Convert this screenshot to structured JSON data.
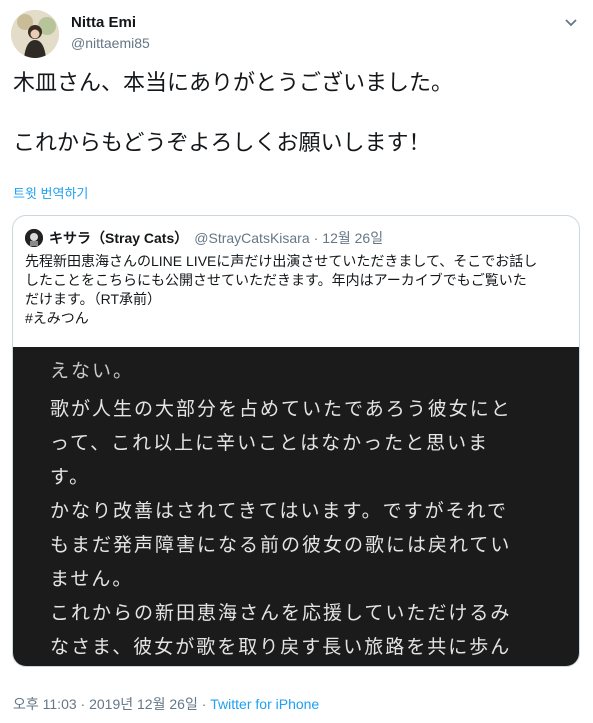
{
  "author": {
    "name": "Nitta Emi",
    "handle": "@nittaemi85"
  },
  "tweet": {
    "line1": "木皿さん、本当にありがとうございました。",
    "line2": "これからもどうぞよろしくお願いします！",
    "translate_label": "트윗 번역하기"
  },
  "quote": {
    "name": "キサラ（Stray Cats）",
    "handle": "@StrayCatsKisara",
    "separator": "·",
    "date": "12월 26일",
    "text_line1": "先程新田恵海さんのLINE LIVEに声だけ出演させていただきまして、そこでお話し",
    "text_line2": "したことをこちらにも公開させていただきます。年内はアーカイブでもご覧いた",
    "text_line3": "だけます。（RT承前）",
    "text_line4": "#えみつん",
    "media": {
      "lines": [
        "えない。",
        "歌が人生の大部分を占めていたであろう彼女にと",
        "って、これ以上に辛いことはなかったと思いま",
        "す。",
        "かなり改善はされてきてはいます。ですがそれで",
        "もまだ発声障害になる前の彼女の歌には戻れてい",
        "ません。",
        "これからの新田恵海さんを応援していただけるみ",
        "なさま、彼女が歌を取り戻す長い旅路を共に歩ん"
      ]
    }
  },
  "meta": {
    "time": "오후 11:03",
    "separator": "·",
    "date": "2019년 12월 26일",
    "source": "Twitter for iPhone"
  },
  "colors": {
    "link": "#1da1f2",
    "secondary_text": "#657786",
    "border": "#ccd6dd",
    "media_bg": "#1b1b1c"
  }
}
